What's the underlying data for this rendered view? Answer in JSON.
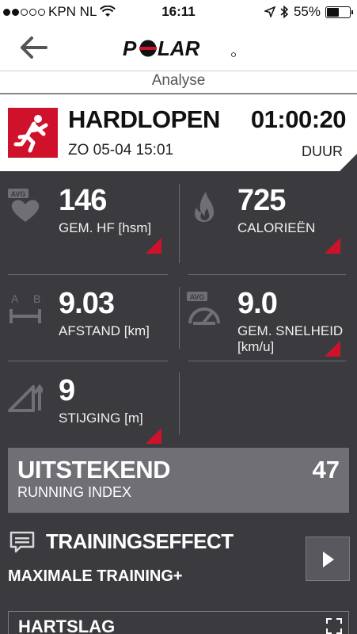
{
  "status_bar": {
    "carrier": "KPN NL",
    "time": "16:11",
    "battery": "55%",
    "battery_level": 0.55,
    "signal_bars_filled": 2
  },
  "header": {
    "logo_text": "POLAR",
    "subtitle": "Analyse"
  },
  "session": {
    "sport": "HARDLOPEN",
    "datetime": "ZO 05-04 15:01",
    "duration": "01:00:20",
    "duration_label": "DUUR",
    "icon": "running-icon"
  },
  "metrics": {
    "heart_rate": {
      "value": "146",
      "label": "GEM. HF [hsm]",
      "badge": "AVG",
      "icon": "heart-icon"
    },
    "calories": {
      "value": "725",
      "label": "CALORIEËN",
      "icon": "flame-icon"
    },
    "distance": {
      "value": "9.03",
      "label": "AFSTAND [km]",
      "icon_a": "A",
      "icon_b": "B",
      "icon": "distance-icon"
    },
    "speed": {
      "value": "9.0",
      "label": "GEM. SNELHEID [km/u]",
      "badge": "AVG",
      "icon": "speedometer-icon"
    },
    "ascent": {
      "value": "9",
      "label": "STIJGING [m]",
      "icon": "ascent-icon"
    }
  },
  "running_index": {
    "title": "UITSTEKEND",
    "subtitle": "RUNNING INDEX",
    "value": "47"
  },
  "training_effect": {
    "title": "TRAININGSEFFECT",
    "subtitle": "MAXIMALE TRAINING+"
  },
  "heart_rate_section": {
    "title": "HARTSLAG"
  },
  "colors": {
    "brand_red": "#d0112b",
    "background": "#3b3b3f",
    "panel": "#6f6f75"
  }
}
